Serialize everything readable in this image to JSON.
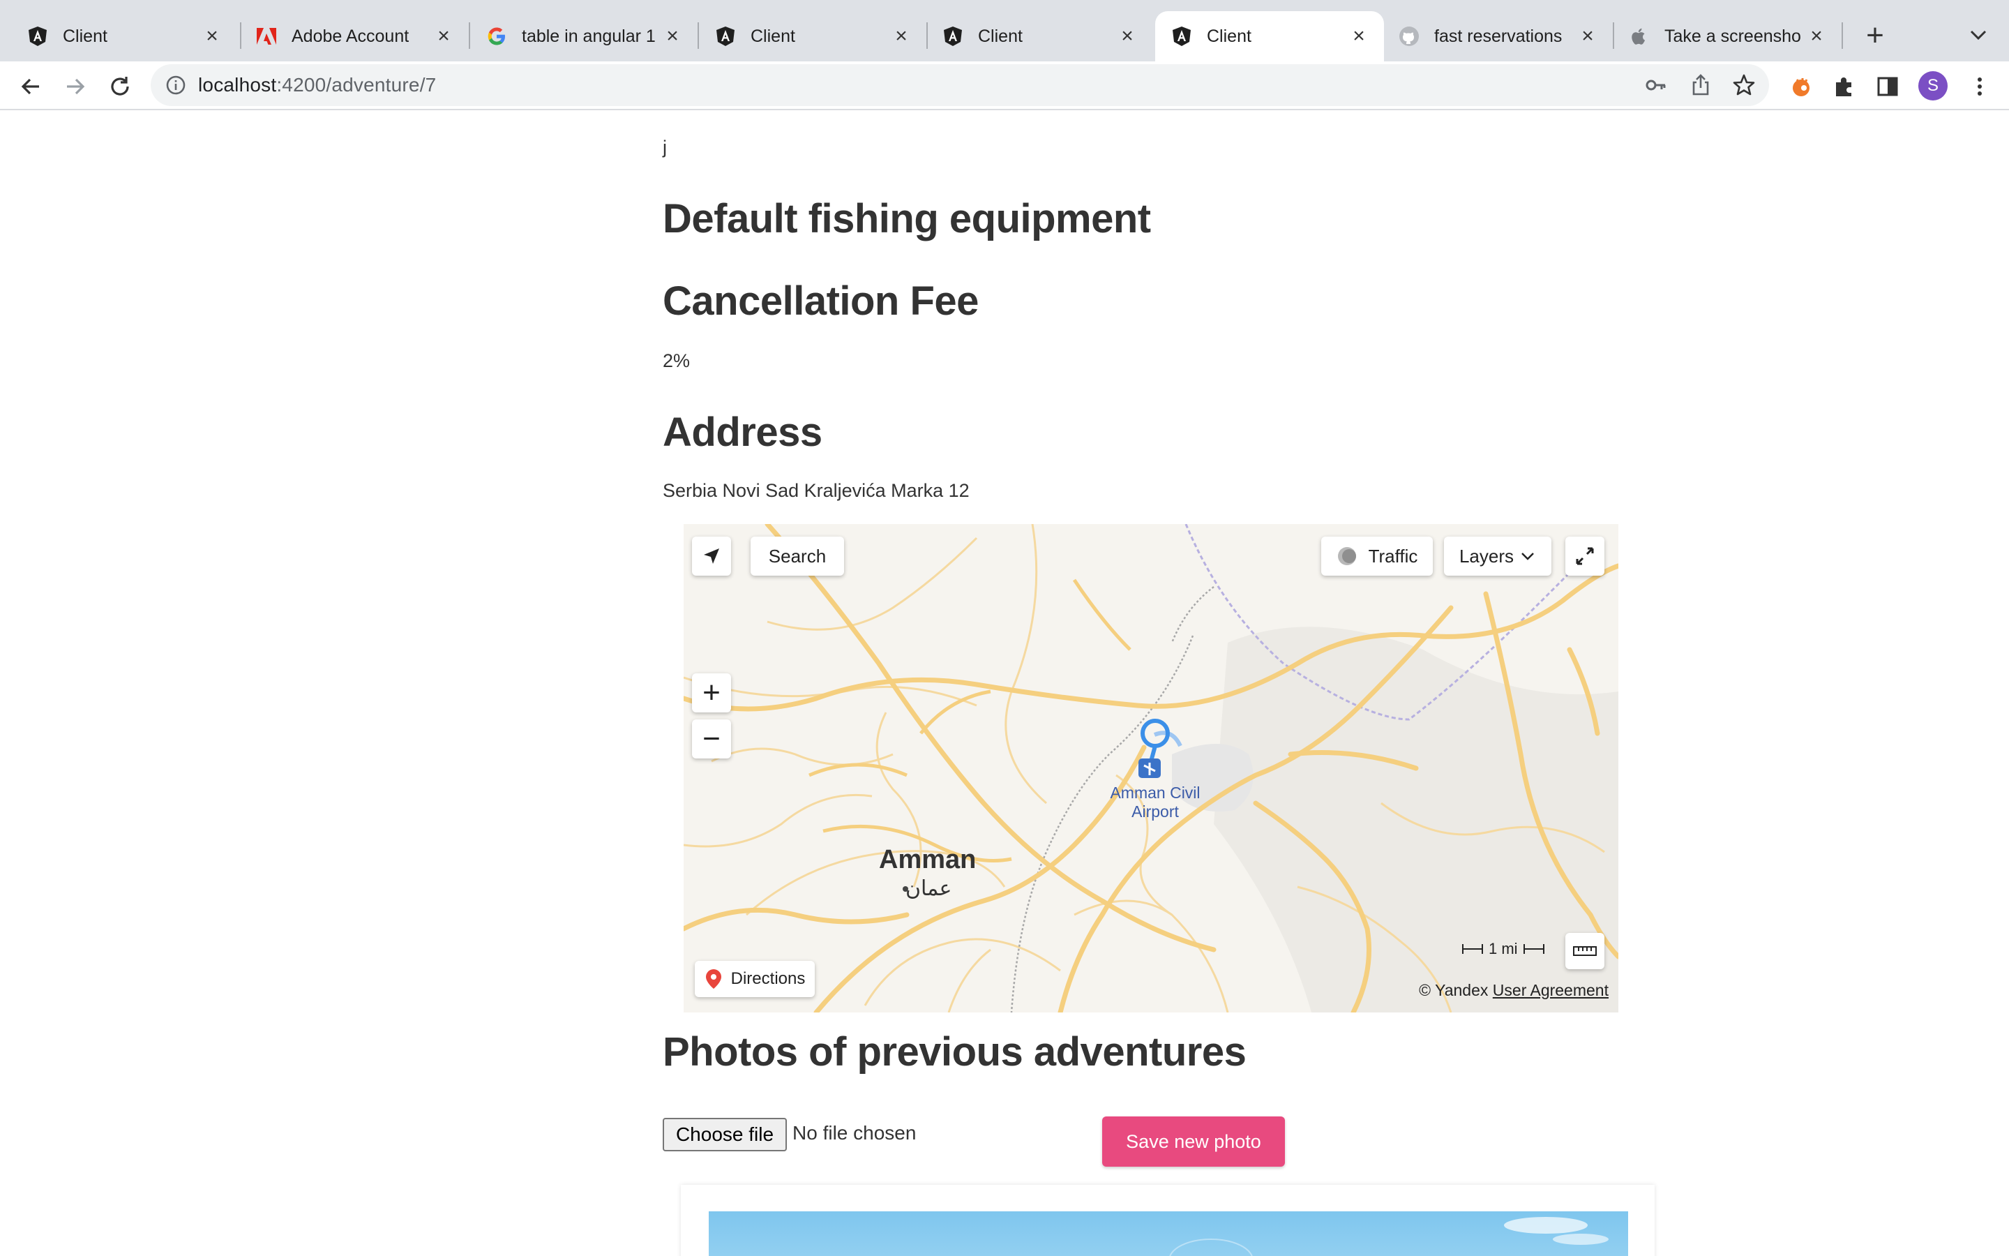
{
  "browser": {
    "tabs": [
      {
        "title": "Client",
        "icon": "angular-icon",
        "active": false
      },
      {
        "title": "Adobe Account",
        "icon": "adobe-icon",
        "active": false
      },
      {
        "title": "table in angular 1",
        "icon": "google-icon",
        "active": false
      },
      {
        "title": "Client",
        "icon": "angular-icon",
        "active": false
      },
      {
        "title": "Client",
        "icon": "angular-icon",
        "active": false
      },
      {
        "title": "Client",
        "icon": "angular-icon",
        "active": true
      },
      {
        "title": "fast reservations",
        "icon": "github-icon",
        "active": false
      },
      {
        "title": "Take a screensho",
        "icon": "apple-icon",
        "active": false
      }
    ],
    "new_tab": "+",
    "url_host": "localhost",
    "url_rest": ":4200/adventure/7",
    "profile_initial": "S"
  },
  "page": {
    "top_text": "j",
    "equipment_heading": "Default fishing equipment",
    "cancellation_heading": "Cancellation Fee",
    "cancellation_value": "2%",
    "address_heading": "Address",
    "address_value": "Serbia Novi Sad Kraljevića Marka 12",
    "photos_heading": "Photos of previous adventures",
    "choose_file_label": "Choose file",
    "no_file_label": "No file chosen",
    "save_photo_label": "Save new photo"
  },
  "map": {
    "search_label": "Search",
    "traffic_label": "Traffic",
    "layers_label": "Layers",
    "directions_label": "Directions",
    "zoom_in": "+",
    "zoom_out": "−",
    "city_label": "Amman",
    "city_label_ar": "عمان",
    "airport_label_1": "Amman Civil",
    "airport_label_2": "Airport",
    "scale_label": "1 mi",
    "copyright_label": "© Yandex",
    "agreement_label": "User Agreement",
    "colors": {
      "road": "#f5cf7f",
      "marker": "#3b8fe8",
      "background": "#f6f4ef"
    }
  }
}
